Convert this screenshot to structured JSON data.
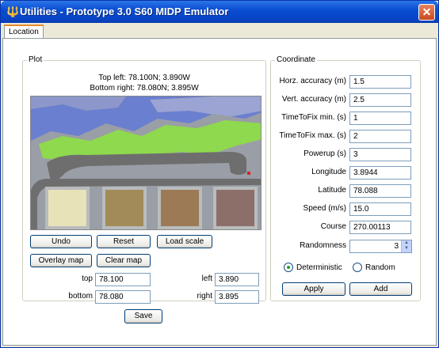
{
  "window": {
    "title": "Utilities - Prototype 3.0 S60 MIDP Emulator",
    "close_glyph": "✕",
    "app_icon_glyph": "🔱"
  },
  "tabs": [
    {
      "label": "Location",
      "active": true
    }
  ],
  "plot": {
    "legend": "Plot",
    "top_left": "Top left: 78.100N; 3.890W",
    "bottom_right": "Bottom right: 78.080N; 3.895W",
    "buttons": {
      "undo": "Undo",
      "reset": "Reset",
      "load_scale": "Load scale",
      "overlay_map": "Overlay map",
      "clear_map": "Clear map"
    },
    "fields": {
      "top_label": "top",
      "top_value": "78.100",
      "bottom_label": "bottom",
      "bottom_value": "78.080",
      "left_label": "left",
      "left_value": "3.890",
      "right_label": "right",
      "right_value": "3.895"
    }
  },
  "coordinate": {
    "legend": "Coordinate",
    "rows": [
      {
        "label": "Horz. accuracy (m)",
        "value": "1.5"
      },
      {
        "label": "Vert. accuracy (m)",
        "value": "2.5"
      },
      {
        "label": "TimeToFix min. (s)",
        "value": "1"
      },
      {
        "label": "TimeToFix max. (s)",
        "value": "2"
      },
      {
        "label": "Powerup (s)",
        "value": "3"
      },
      {
        "label": "Longitude",
        "value": "3.8944"
      },
      {
        "label": "Latitude",
        "value": "78.088"
      },
      {
        "label": "Speed (m/s)",
        "value": "15.0"
      },
      {
        "label": "Course",
        "value": "270.00113"
      }
    ],
    "randomness_label": "Randomness",
    "randomness_value": "3",
    "mode_options": [
      {
        "label": "Deterministic",
        "selected": true
      },
      {
        "label": "Random",
        "selected": false
      }
    ],
    "apply_label": "Apply",
    "add_label": "Add"
  },
  "save_label": "Save",
  "colors": {
    "title_bar": "#0a4ed2",
    "close_button": "#d5582b",
    "selected_radio": "#21a121",
    "map_water": "#6a7fcf",
    "map_land": "#8ed94e",
    "map_road": "#6e6e6e"
  }
}
